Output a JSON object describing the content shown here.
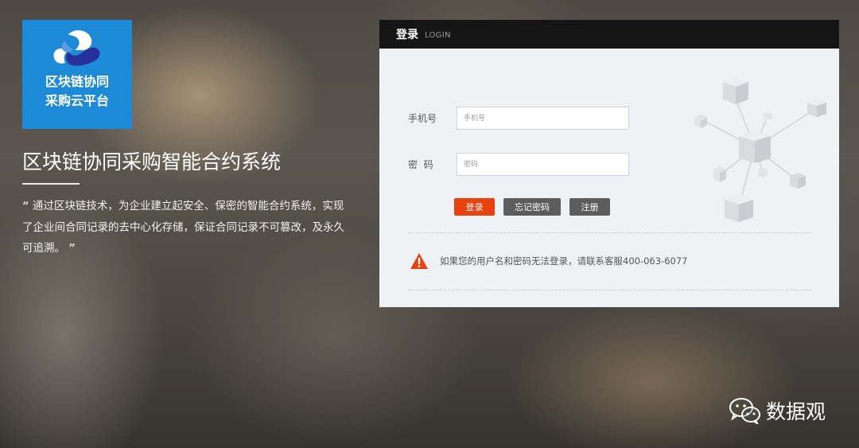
{
  "brand": {
    "logo_line1": "区块链协同",
    "logo_line2": "采购云平台",
    "colors": {
      "logo_bg": "#1c8ad6",
      "accent": "#e8420f"
    }
  },
  "hero": {
    "title": "区块链协同采购智能合约系统",
    "open_quote": "“",
    "description": "通过区块链技术，为企业建立起安全、保密的智能合约系统，实现了企业间合同记录的去中心化存储，保证合同记录不可篡改，及永久可追溯。",
    "close_quote": "”"
  },
  "login": {
    "title": "登录",
    "subtitle": "LOGIN",
    "phone_label": "手机号",
    "phone_placeholder": "手机号",
    "password_label": "密  码",
    "password_placeholder": "密码",
    "login_button": "登录",
    "forgot_button": "忘记密码",
    "register_button": "注册",
    "notice": "如果您的用户名和密码无法登录，请联系客服400-063-6077",
    "notice_icon": "warning-triangle-icon"
  },
  "watermark": {
    "text": "数据观",
    "icon": "wechat-icon"
  }
}
